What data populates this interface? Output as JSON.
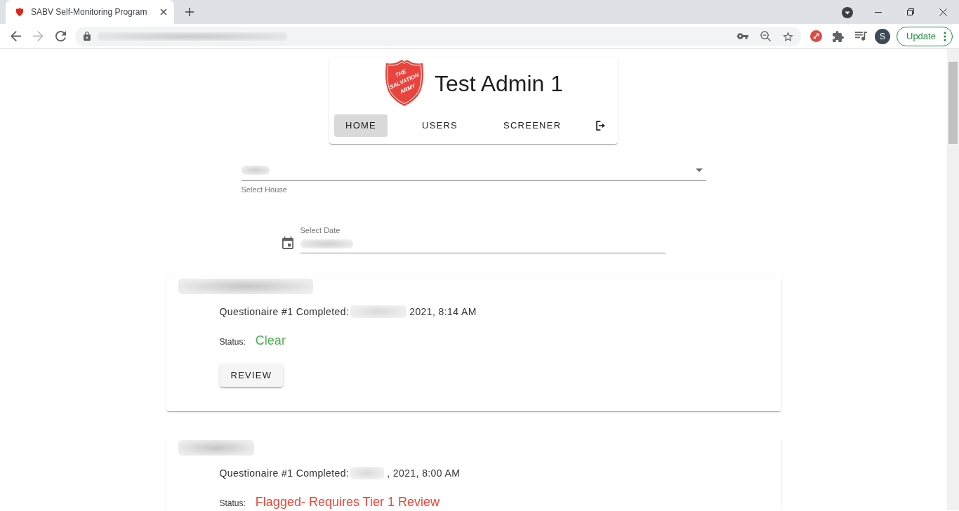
{
  "browser": {
    "tab_title": "SABV Self-Monitoring Program",
    "forward_button": {
      "disabled": true
    },
    "profile_initial": "S",
    "update_label": "Update"
  },
  "header": {
    "logo_text": [
      "THE",
      "SALVATION",
      "ARMY"
    ],
    "title": "Test Admin 1",
    "nav": [
      {
        "label": "HOME",
        "selected": true
      },
      {
        "label": "USERS",
        "selected": false
      },
      {
        "label": "SCREENER",
        "selected": false
      }
    ]
  },
  "house_select": {
    "helper": "Select House"
  },
  "date_field": {
    "label": "Select Date"
  },
  "submissions": [
    {
      "completed_label": "Questionaire #1 Completed:",
      "completed_time": "2021, 8:14 AM",
      "status_label": "Status:",
      "status": "Clear",
      "color": "#4caf50",
      "button": "REVIEW"
    },
    {
      "completed_label": "Questionaire #1 Completed:",
      "completed_time": ", 2021, 8:00 AM",
      "status_label": "Status:",
      "status": "Flagged- Requires Tier 1 Review",
      "color": "#f44336"
    }
  ]
}
